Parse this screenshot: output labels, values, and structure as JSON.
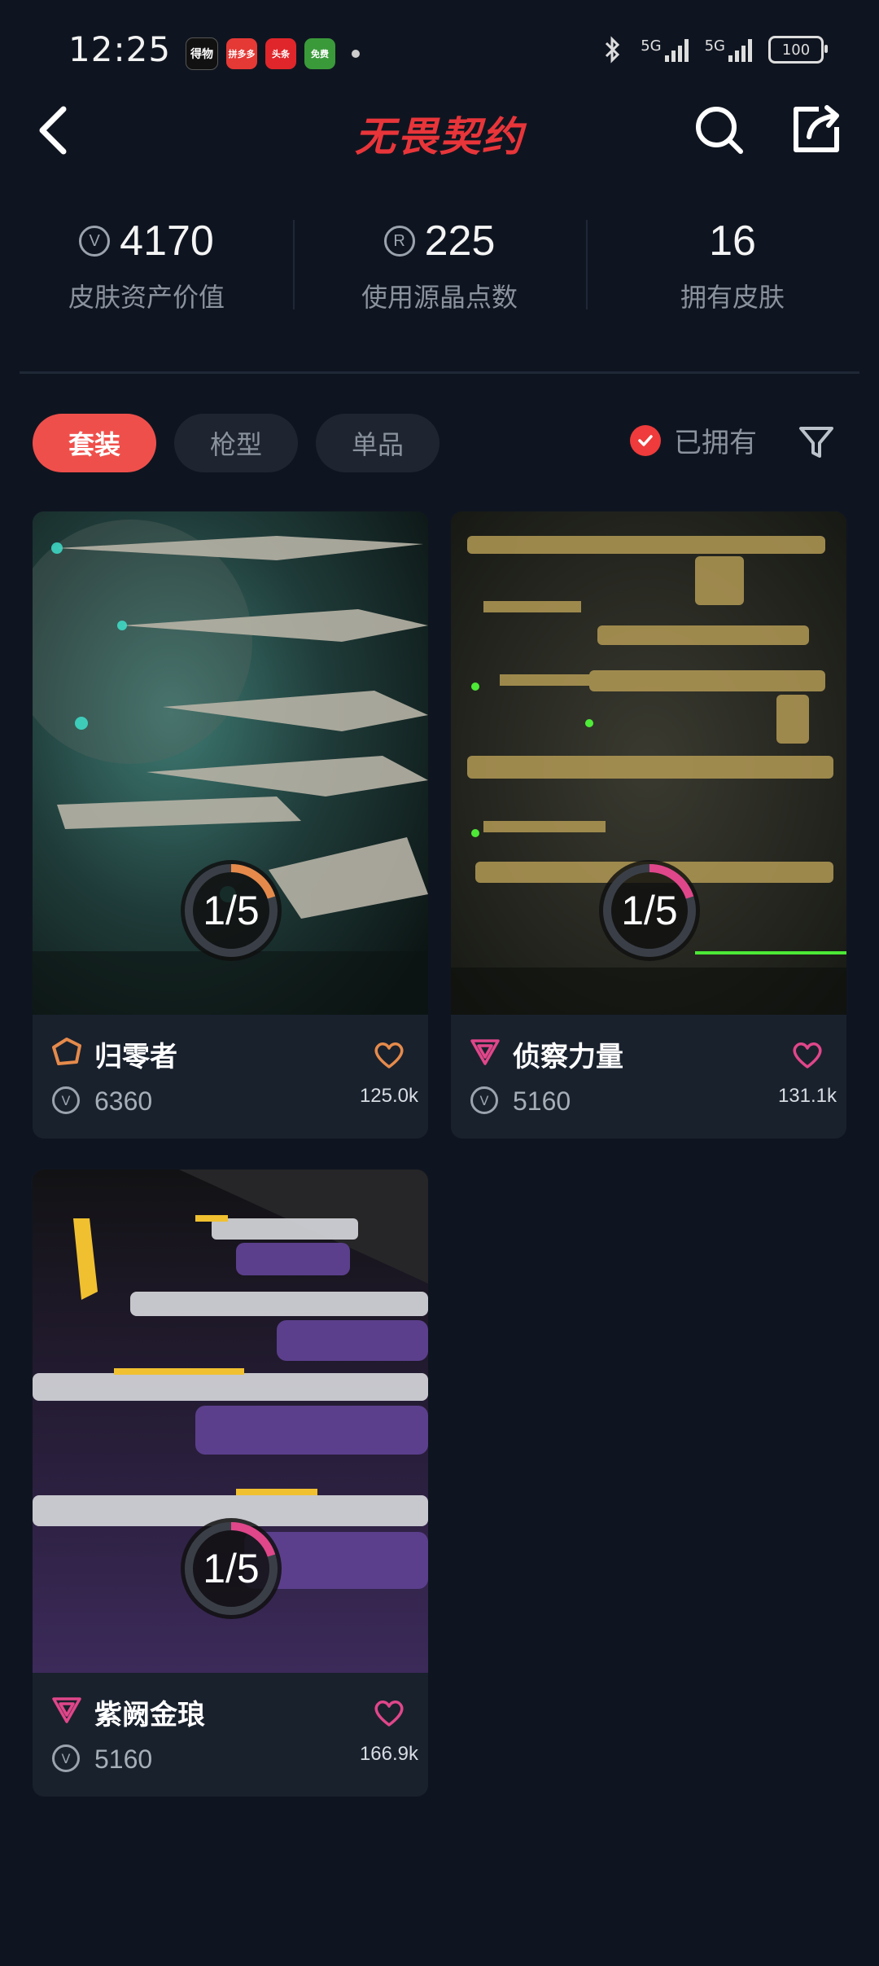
{
  "status_bar": {
    "time": "12:25",
    "notifications": [
      "得物",
      "拼多多",
      "头条",
      "免费"
    ],
    "network": [
      "5G",
      "5G"
    ],
    "battery": "100"
  },
  "header": {
    "brand_title": "无畏契约"
  },
  "stats": [
    {
      "value": "4170",
      "label": "皮肤资产价值",
      "icon": "valorant-points-icon"
    },
    {
      "value": "225",
      "label": "使用源晶点数",
      "icon": "radianite-icon"
    },
    {
      "value": "16",
      "label": "拥有皮肤",
      "icon": ""
    }
  ],
  "tabs": [
    {
      "label": "套装",
      "active": true
    },
    {
      "label": "枪型",
      "active": false
    },
    {
      "label": "单品",
      "active": false
    }
  ],
  "owned_filter": {
    "label": "已拥有",
    "checked": true
  },
  "cards": [
    {
      "name": "归零者",
      "price": "6360",
      "likes": "125.0k",
      "progress_text": "1/5",
      "progress_fraction": 0.2,
      "tier_color": "#e58a4b",
      "heart_color": "#e58a4b",
      "theme": "teal"
    },
    {
      "name": "侦察力量",
      "price": "5160",
      "likes": "131.1k",
      "progress_text": "1/5",
      "progress_fraction": 0.2,
      "tier_color": "#e0468a",
      "heart_color": "#e0468a",
      "theme": "gold"
    },
    {
      "name": "紫阙金琅",
      "price": "5160",
      "likes": "166.9k",
      "progress_text": "1/5",
      "progress_fraction": 0.2,
      "tier_color": "#e0468a",
      "heart_color": "#e0468a",
      "theme": "purple"
    }
  ],
  "colors": {
    "background": "#0f1520",
    "accent": "#ef4f4b",
    "card_bg": "#19212d",
    "muted_text": "#8a929e"
  }
}
